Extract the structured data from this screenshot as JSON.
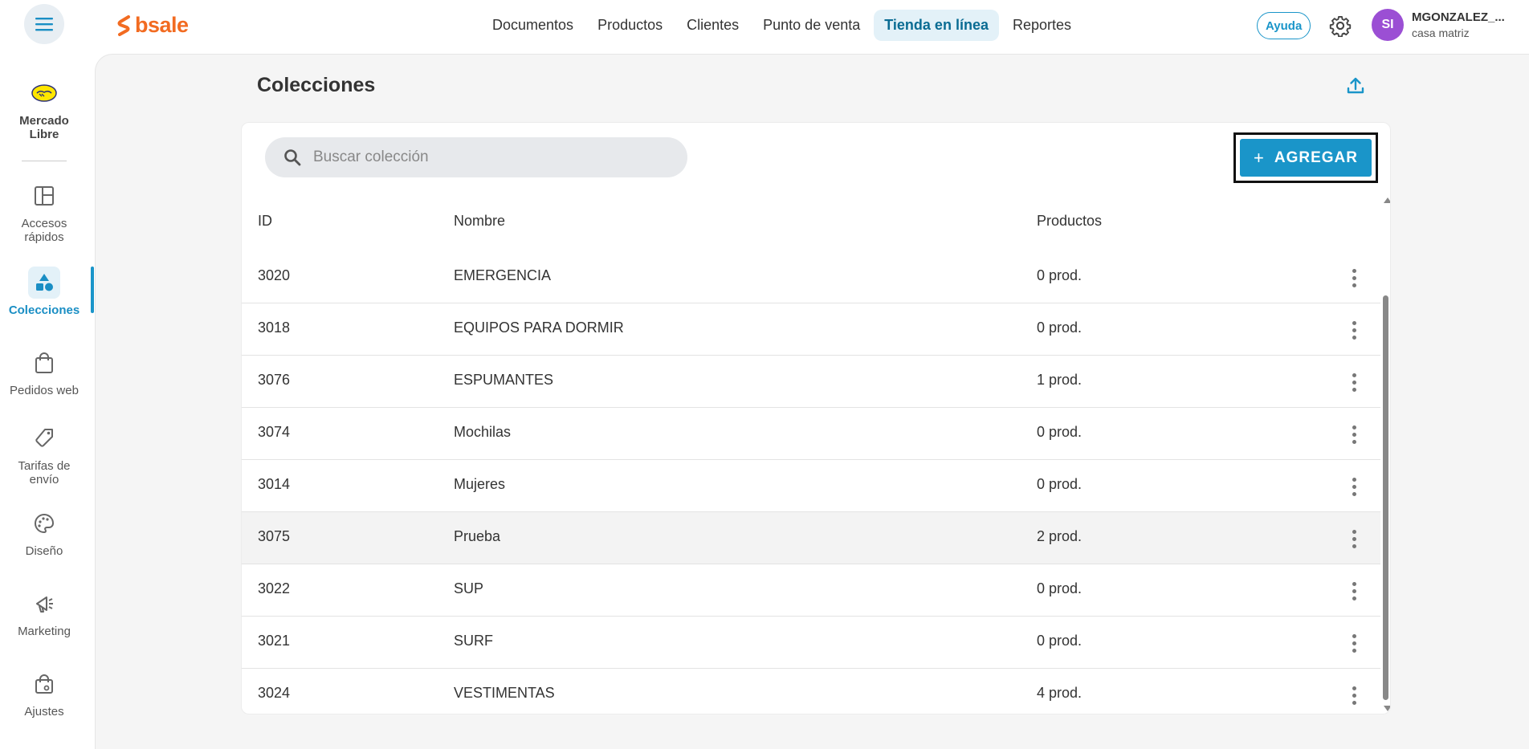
{
  "header": {
    "logo_text": "bsale",
    "nav": [
      {
        "label": "Documentos",
        "active": false
      },
      {
        "label": "Productos",
        "active": false
      },
      {
        "label": "Clientes",
        "active": false
      },
      {
        "label": "Punto de venta",
        "active": false
      },
      {
        "label": "Tienda en línea",
        "active": true
      },
      {
        "label": "Reportes",
        "active": false
      }
    ],
    "help_label": "Ayuda",
    "avatar_initials": "SI",
    "user_name": "MGONZALEZ_...",
    "user_branch": "casa matriz"
  },
  "sidebar": {
    "marketplace_label": "Mercado Libre",
    "items": [
      {
        "label": "Accesos rápidos",
        "icon": "layout-icon"
      },
      {
        "label": "Colecciones",
        "icon": "shapes-icon",
        "active": true
      },
      {
        "label": "Pedidos web",
        "icon": "shopping-bag-icon"
      },
      {
        "label": "Tarifas de envío",
        "icon": "tag-icon"
      },
      {
        "label": "Diseño",
        "icon": "palette-icon"
      },
      {
        "label": "Marketing",
        "icon": "megaphone-icon"
      },
      {
        "label": "Ajustes",
        "icon": "settings-bag-icon"
      }
    ]
  },
  "main": {
    "title": "Colecciones",
    "search_placeholder": "Buscar colección",
    "add_button": "AGREGAR",
    "add_button_icon": "+",
    "columns": [
      "ID",
      "Nombre",
      "Productos"
    ],
    "rows": [
      {
        "id": "3020",
        "name": "EMERGENCIA",
        "products": "0 prod."
      },
      {
        "id": "3018",
        "name": "EQUIPOS PARA DORMIR",
        "products": "0 prod."
      },
      {
        "id": "3076",
        "name": "ESPUMANTES",
        "products": "1 prod."
      },
      {
        "id": "3074",
        "name": "Mochilas",
        "products": "0 prod."
      },
      {
        "id": "3014",
        "name": "Mujeres",
        "products": "0 prod."
      },
      {
        "id": "3075",
        "name": "Prueba",
        "products": "2 prod."
      },
      {
        "id": "3022",
        "name": "SUP",
        "products": "0 prod."
      },
      {
        "id": "3021",
        "name": "SURF",
        "products": "0 prod."
      },
      {
        "id": "3024",
        "name": "VESTIMENTAS",
        "products": "4 prod."
      }
    ],
    "highlighted_row": 5
  },
  "colors": {
    "brand": "#f26b21",
    "accent": "#1a95c9",
    "avatar": "#9b4fd4"
  }
}
